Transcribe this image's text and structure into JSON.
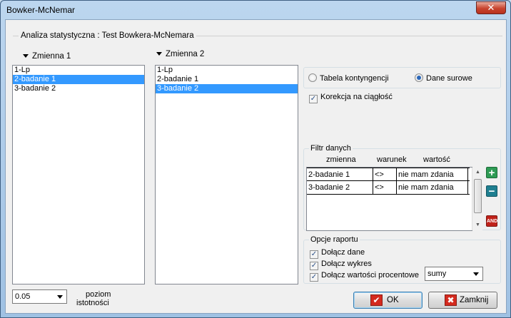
{
  "window": {
    "title": "Bowker-McNemar",
    "close_glyph": "✕"
  },
  "group_title": "Analiza statystyczna : Test Bowkera-McNemara",
  "var1": {
    "header": "Zmienna 1",
    "items": [
      "1-Lp",
      "2-badanie 1",
      "3-badanie 2"
    ],
    "selected": 1
  },
  "var2": {
    "header": "Zmienna 2",
    "items": [
      "1-Lp",
      "2-badanie 1",
      "3-badanie 2"
    ],
    "selected": 2
  },
  "data_type": {
    "option1": "Tabela kontyngencji",
    "option2": "Dane surowe",
    "selected": "option2"
  },
  "continuity": {
    "label": "Korekcja na ciągłość",
    "checked": true
  },
  "filter": {
    "title": "Filtr danych",
    "headers": [
      "zmienna",
      "warunek",
      "wartość"
    ],
    "rows": [
      {
        "variable": "2-badanie 1",
        "condition": "<>",
        "value": "nie mam zdania"
      },
      {
        "variable": "3-badanie 2",
        "condition": "<>",
        "value": "nie mam zdania"
      }
    ],
    "add_glyph": "+",
    "remove_glyph": "−",
    "and_label": "AND"
  },
  "report": {
    "title": "Opcje raportu",
    "include_data": "Dołącz dane",
    "include_chart": "Dołącz wykres",
    "include_percent": "Dołącz wartości procentowe",
    "percent_mode": "sumy"
  },
  "significance": {
    "value": "0.05",
    "label_line1": "poziom",
    "label_line2": "istotności"
  },
  "buttons": {
    "ok": "OK",
    "close": "Zamknij",
    "ok_glyph": "✔",
    "close_glyph": "✖"
  },
  "colors": {
    "selection": "#3399ff",
    "add": "#2e9b54",
    "remove": "#1f7f90",
    "and": "#c0221a"
  }
}
